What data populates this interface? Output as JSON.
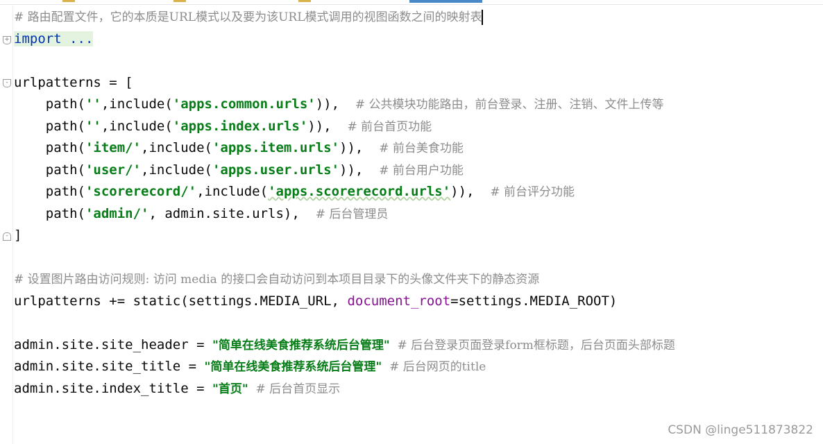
{
  "code": {
    "line1_comment": "# 路由配置文件，它的本质是URL模式以及要为该URL模式调用的视图函数之间的映射表",
    "line2_import": "import ...",
    "line4": "urlpatterns = [",
    "p1": {
      "pre": "    path(",
      "arg1": "''",
      "mid": ",include(",
      "arg2": "'apps.common.urls'",
      "post": ")),  ",
      "comment": "# 公共模块功能路由，前台登录、注册、注销、文件上传等"
    },
    "p2": {
      "pre": "    path(",
      "arg1": "''",
      "mid": ",include(",
      "arg2": "'apps.index.urls'",
      "post": ")),  ",
      "comment": "# 前台首页功能"
    },
    "p3": {
      "pre": "    path(",
      "arg1": "'item/'",
      "mid": ",include(",
      "arg2": "'apps.item.urls'",
      "post": ")),  ",
      "comment": "# 前台美食功能"
    },
    "p4": {
      "pre": "    path(",
      "arg1": "'user/'",
      "mid": ",include(",
      "arg2": "'apps.user.urls'",
      "post": ")),  ",
      "comment": "# 前台用户功能"
    },
    "p5": {
      "pre": "    path(",
      "arg1": "'scorerecord/'",
      "mid": ",include(",
      "arg2": "'apps.scorerecord.urls'",
      "post": ")),  ",
      "comment": "# 前台评分功能"
    },
    "p6": {
      "pre": "    path(",
      "arg1": "'admin/'",
      "mid": ", admin.site.urls),  ",
      "comment": "# 后台管理员"
    },
    "close": "]",
    "media_comment": "# 设置图片路由访问规则: 访问 media 的接口会自动访问到本项目目录下的头像文件夹下的静态资源",
    "static_pre": "urlpatterns += static(settings.MEDIA_URL, ",
    "static_param": "document_root",
    "static_post": "=settings.MEDIA_ROOT)",
    "header": {
      "pre": "admin.site.site_header = ",
      "str": "\"简单在线美食推荐系统后台管理\"",
      "comment": "  # 后台登录页面登录form框标题，后台页面头部标题"
    },
    "title": {
      "pre": "admin.site.site_title = ",
      "str": "\"简单在线美食推荐系统后台管理\"",
      "comment": "  # 后台网页的title"
    },
    "index": {
      "pre": "admin.site.index_title = ",
      "str": "\"首页\"",
      "comment": "  # 后台首页显示"
    }
  },
  "watermark": "CSDN @linge511873822",
  "colors": {
    "comment": "#8c8c8c",
    "string": "#067d17",
    "keyword": "#0033b3",
    "param": "#871094",
    "import_highlight": "#e4f2e0"
  }
}
